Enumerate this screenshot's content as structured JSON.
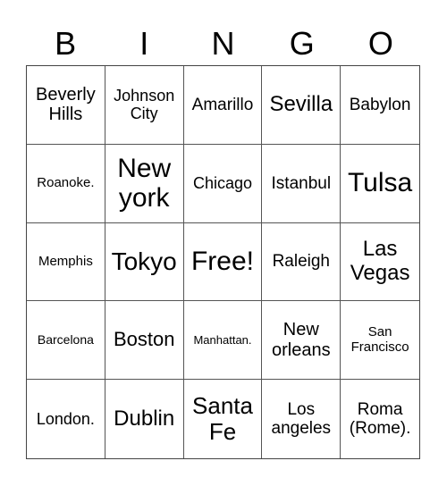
{
  "header": [
    "B",
    "I",
    "N",
    "G",
    "O"
  ],
  "cells": [
    "Beverly Hills",
    "Johnson City",
    "Amarillo",
    "Sevilla",
    "Babylon",
    "Roanoke.",
    "New york",
    "Chicago",
    "Istanbul",
    "Tulsa",
    "Memphis",
    "Tokyo",
    "Free!",
    "Raleigh",
    "Las Vegas",
    "Barcelona",
    "Boston",
    "Manhattan.",
    "New orleans",
    "San Francisco",
    "London.",
    "Dublin",
    "Santa Fe",
    "Los angeles",
    "Roma (Rome)."
  ]
}
